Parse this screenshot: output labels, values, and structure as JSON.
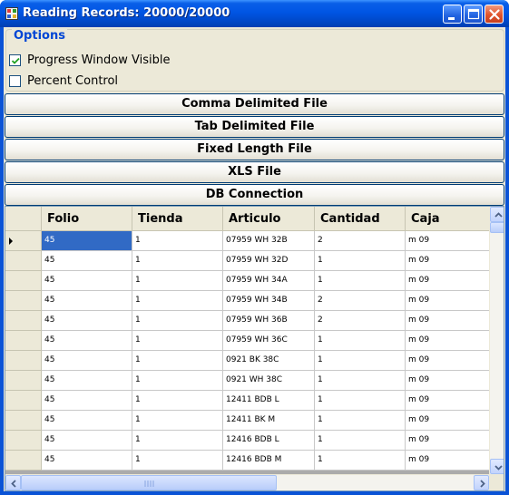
{
  "window": {
    "title": "Reading Records: 20000/20000",
    "icon": "app-icon",
    "controls": [
      "minimize-icon",
      "maximize-icon",
      "close-icon"
    ]
  },
  "options": {
    "legend": "Options",
    "checkboxes": [
      {
        "label": "Progress Window Visible",
        "checked": true
      },
      {
        "label": "Percent Control",
        "checked": false
      }
    ]
  },
  "buttons": [
    "Comma Delimited File",
    "Tab Delimited File",
    "Fixed Length File",
    "XLS File",
    "DB Connection"
  ],
  "grid": {
    "columns": [
      "Folio",
      "Tienda",
      "Articulo",
      "Cantidad",
      "Caja"
    ],
    "current_row_icon": "row-pointer-icon",
    "rows": [
      [
        "45",
        "1",
        "07959 WH 32B",
        "2",
        "m 09"
      ],
      [
        "45",
        "1",
        "07959 WH 32D",
        "1",
        "m 09"
      ],
      [
        "45",
        "1",
        "07959 WH 34A",
        "1",
        "m 09"
      ],
      [
        "45",
        "1",
        "07959 WH 34B",
        "2",
        "m 09"
      ],
      [
        "45",
        "1",
        "07959 WH 36B",
        "2",
        "m 09"
      ],
      [
        "45",
        "1",
        "07959 WH 36C",
        "1",
        "m 09"
      ],
      [
        "45",
        "1",
        "0921 BK 38C",
        "1",
        "m 09"
      ],
      [
        "45",
        "1",
        "0921 WH 38C",
        "1",
        "m 09"
      ],
      [
        "45",
        "1",
        "12411 BDB L",
        "1",
        "m 09"
      ],
      [
        "45",
        "1",
        "12411 BK M",
        "1",
        "m 09"
      ],
      [
        "45",
        "1",
        "12416 BDB L",
        "1",
        "m 09"
      ],
      [
        "45",
        "1",
        "12416 BDB M",
        "1",
        "m 09"
      ]
    ]
  },
  "colors": {
    "titlebar": "#0055e4",
    "selection": "#316ac5",
    "legend_text": "#0046d5",
    "face": "#ece9d8"
  }
}
